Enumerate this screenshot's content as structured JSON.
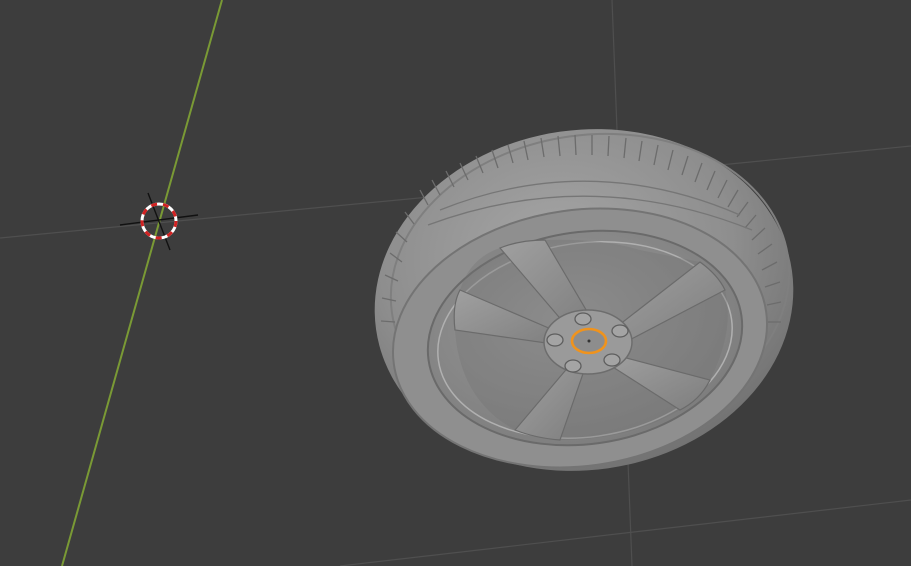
{
  "viewport": {
    "background": "#3d3d3d",
    "grid_color": "#4d4d4d",
    "y_axis_color": "#7a9a35"
  },
  "objects": [
    {
      "name": "tire-wheel-mesh",
      "selected": true
    },
    {
      "name": "3d-cursor"
    }
  ],
  "colors": {
    "selection_outline": "#f0931c",
    "cursor_red": "#d22222",
    "cursor_white": "#ffffff",
    "mesh_gray": "#8c8c8c",
    "mesh_dark": "#5c5c5c",
    "mesh_light": "#a8a8a8"
  }
}
